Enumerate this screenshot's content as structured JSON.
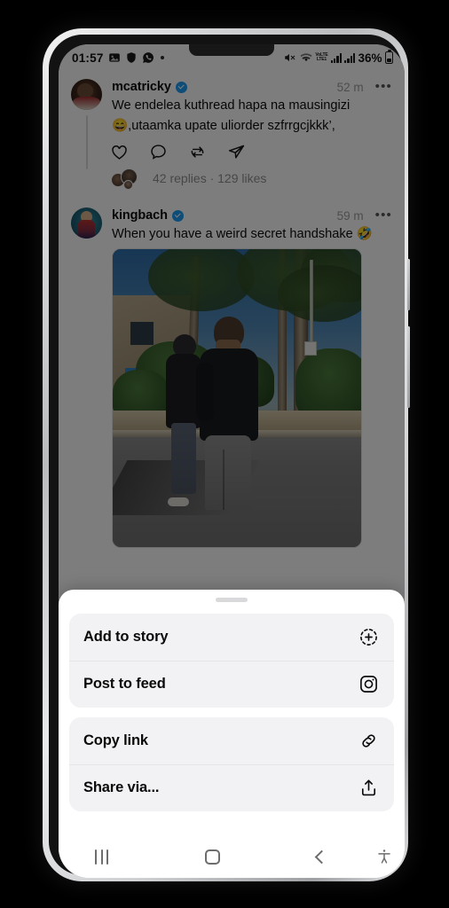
{
  "statusbar": {
    "time": "01:57",
    "left_icons": [
      "photos-icon",
      "shield-icon",
      "whatsapp-icon",
      "dot-indicator"
    ],
    "right_icons": [
      "mute-icon",
      "wifi-icon",
      "volte-icon",
      "signal-bars-icon",
      "signal-bars-2-icon"
    ],
    "volte_top": "VoLTE",
    "volte_bottom": "LTE1",
    "battery_percent": "36%"
  },
  "feed": {
    "posts": [
      {
        "username": "mcatricky",
        "verified": true,
        "time": "52 m",
        "more_label": "•••",
        "text_line1": "We endelea kuthread hapa na mausingizi",
        "text_line2": "😄,utaamka upate uliorder szfrrgcjkkk’,",
        "actions": [
          "heart-icon",
          "comment-icon",
          "repost-icon",
          "share-icon"
        ],
        "replies_summary": "42 replies · 129 likes"
      },
      {
        "username": "kingbach",
        "verified": true,
        "time": "59 m",
        "more_label": "•••",
        "text_line1": "When you have a weird secret handshake 🤣",
        "media_alt": "photo-street-two-people-palm-trees"
      }
    ]
  },
  "sheet": {
    "grabber_label": "drag-handle",
    "groups": [
      {
        "rows": [
          {
            "label": "Add to story",
            "icon": "add-to-story-icon"
          },
          {
            "label": "Post to feed",
            "icon": "instagram-icon"
          }
        ]
      },
      {
        "rows": [
          {
            "label": "Copy link",
            "icon": "link-icon"
          },
          {
            "label": "Share via...",
            "icon": "share-upload-icon"
          }
        ]
      }
    ]
  },
  "navbar": {
    "recents_label": "recents-icon",
    "home_label": "home-icon",
    "back_label": "back-icon",
    "accessibility_label": "accessibility-icon"
  },
  "colors": {
    "verified_blue": "#1d9bf0",
    "sheet_bg": "#ffffff",
    "group_bg": "#f2f2f4",
    "muted_text": "#8e8e8e"
  }
}
